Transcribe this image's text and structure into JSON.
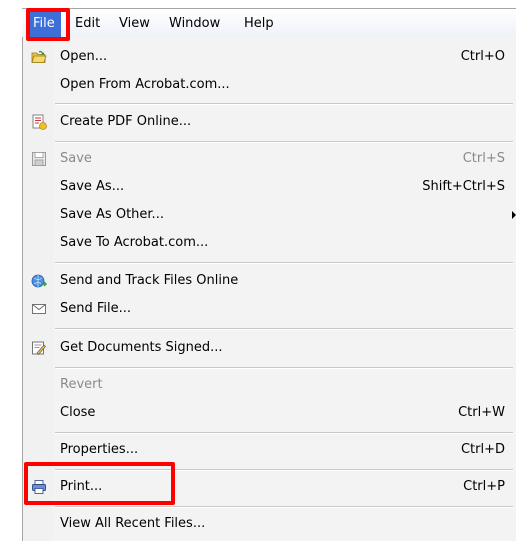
{
  "menubar": {
    "items": [
      {
        "label": "File",
        "active": true
      },
      {
        "label": "Edit"
      },
      {
        "label": "View"
      },
      {
        "label": "Window"
      },
      {
        "label": "Help"
      }
    ]
  },
  "menu": {
    "open": {
      "label": "Open...",
      "shortcut": "Ctrl+O",
      "icon": "open-folder-icon"
    },
    "open_from_acrobat": {
      "label": "Open From Acrobat.com..."
    },
    "create_pdf_online": {
      "label": "Create PDF Online...",
      "icon": "create-pdf-icon"
    },
    "save": {
      "label": "Save",
      "shortcut": "Ctrl+S",
      "icon": "save-disk-icon",
      "disabled": true
    },
    "save_as": {
      "label": "Save As...",
      "shortcut": "Shift+Ctrl+S"
    },
    "save_as_other": {
      "label": "Save As Other...",
      "has_submenu": true
    },
    "save_to_acrobat": {
      "label": "Save To Acrobat.com..."
    },
    "send_and_track": {
      "label": "Send and Track Files Online",
      "icon": "globe-send-icon"
    },
    "send_file": {
      "label": "Send File...",
      "icon": "envelope-icon"
    },
    "get_documents_signed": {
      "label": "Get Documents Signed...",
      "icon": "sign-document-icon"
    },
    "revert": {
      "label": "Revert",
      "disabled": true
    },
    "close": {
      "label": "Close",
      "shortcut": "Ctrl+W"
    },
    "properties": {
      "label": "Properties...",
      "shortcut": "Ctrl+D"
    },
    "print": {
      "label": "Print...",
      "shortcut": "Ctrl+P",
      "icon": "printer-icon"
    },
    "view_all_recent": {
      "label": "View All Recent Files..."
    }
  },
  "colors": {
    "highlight": "#ff0000",
    "menubar_active": "#3c6fd8",
    "disabled_text": "#8a8a8a"
  }
}
